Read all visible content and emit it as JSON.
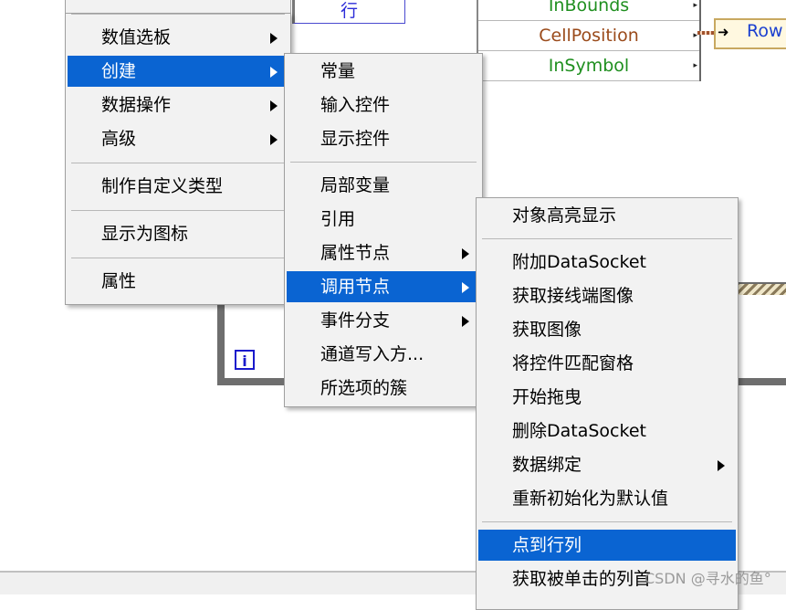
{
  "background": {
    "row_box_label": "行",
    "property_node_items": [
      {
        "label": "InBounds",
        "color": "#1f8f1f"
      },
      {
        "label": "CellPosition",
        "color": "#9a4a1a"
      },
      {
        "label": "InSymbol",
        "color": "#1f8f1f"
      }
    ],
    "row_indicator_label": "Row",
    "iteration_terminal": "i"
  },
  "menu_level1": {
    "items": [
      {
        "label": "数值选板",
        "submenu": true,
        "highlighted": false
      },
      {
        "label": "创建",
        "submenu": true,
        "highlighted": true
      },
      {
        "label": "数据操作",
        "submenu": true,
        "highlighted": false
      },
      {
        "label": "高级",
        "submenu": true,
        "highlighted": false
      },
      {
        "label": "制作自定义类型",
        "submenu": false,
        "highlighted": false
      },
      {
        "label": "显示为图标",
        "submenu": false,
        "highlighted": false
      },
      {
        "label": "属性",
        "submenu": false,
        "highlighted": false
      }
    ]
  },
  "menu_level2": {
    "items": [
      {
        "label": "常量",
        "submenu": false,
        "highlighted": false
      },
      {
        "label": "输入控件",
        "submenu": false,
        "highlighted": false
      },
      {
        "label": "显示控件",
        "submenu": false,
        "highlighted": false
      },
      {
        "label": "局部变量",
        "submenu": false,
        "highlighted": false
      },
      {
        "label": "引用",
        "submenu": false,
        "highlighted": false
      },
      {
        "label": "属性节点",
        "submenu": true,
        "highlighted": false
      },
      {
        "label": "调用节点",
        "submenu": true,
        "highlighted": true
      },
      {
        "label": "事件分支",
        "submenu": true,
        "highlighted": false
      },
      {
        "label": "通道写入方...",
        "submenu": false,
        "highlighted": false
      },
      {
        "label": "所选项的簇",
        "submenu": false,
        "highlighted": false
      }
    ]
  },
  "menu_level3": {
    "items": [
      {
        "label": "对象高亮显示",
        "submenu": false,
        "highlighted": false
      },
      {
        "label": "附加DataSocket",
        "submenu": false,
        "highlighted": false
      },
      {
        "label": "获取接线端图像",
        "submenu": false,
        "highlighted": false
      },
      {
        "label": "获取图像",
        "submenu": false,
        "highlighted": false
      },
      {
        "label": "将控件匹配窗格",
        "submenu": false,
        "highlighted": false
      },
      {
        "label": "开始拖曳",
        "submenu": false,
        "highlighted": false
      },
      {
        "label": "删除DataSocket",
        "submenu": false,
        "highlighted": false
      },
      {
        "label": "数据绑定",
        "submenu": true,
        "highlighted": false
      },
      {
        "label": "重新初始化为默认值",
        "submenu": false,
        "highlighted": false
      },
      {
        "label": "点到行列",
        "submenu": false,
        "highlighted": true
      },
      {
        "label": "获取被单击的列首",
        "submenu": false,
        "highlighted": false
      }
    ]
  },
  "watermark": "CSDN @寻水的鱼°",
  "colors": {
    "menu_background": "#f2f2f2",
    "highlight": "#0a64d2",
    "highlight_text": "#ffffff"
  }
}
